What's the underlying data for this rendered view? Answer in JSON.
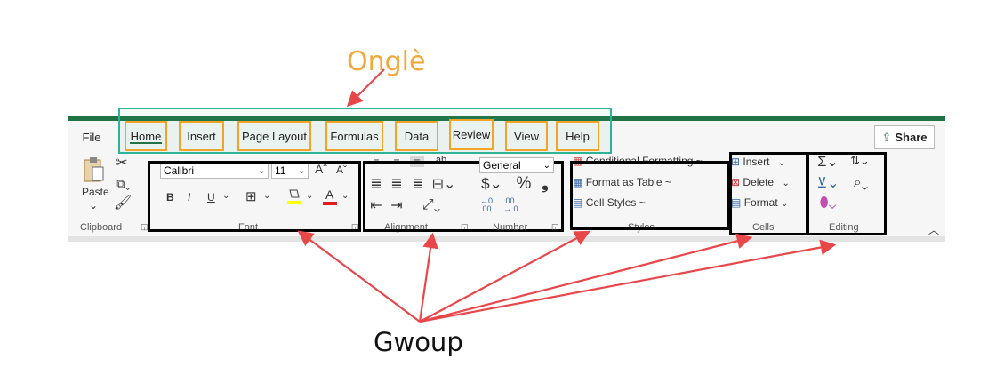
{
  "annotations": {
    "onglet": "Onglè",
    "group": "Gwoup"
  },
  "tabs": [
    {
      "label": "File"
    },
    {
      "label": "Home"
    },
    {
      "label": "Insert"
    },
    {
      "label": "Page Layout"
    },
    {
      "label": "Formulas"
    },
    {
      "label": "Data"
    },
    {
      "label": "Review"
    },
    {
      "label": "View"
    },
    {
      "label": "Help"
    }
  ],
  "share_label": "Share",
  "clipboard": {
    "paste_label": "Paste",
    "group_label": "Clipboard"
  },
  "font": {
    "name": "Calibri",
    "size": "11",
    "group_label": "Font"
  },
  "alignment": {
    "group_label": "Alignment"
  },
  "number": {
    "format": "General",
    "group_label": "Number"
  },
  "styles": {
    "items": [
      "Conditional Formatting ~",
      "Format as Table ~",
      "Cell Styles ~"
    ],
    "group_label": "Styles"
  },
  "cells": {
    "items": [
      "Insert",
      "Delete",
      "Format"
    ],
    "group_label": "Cells"
  },
  "editing": {
    "group_label": "Editing"
  },
  "colors": {
    "green": "#217346",
    "orange": "#f0a52a",
    "teal": "#2fb397",
    "arrow": "#e8474a"
  }
}
